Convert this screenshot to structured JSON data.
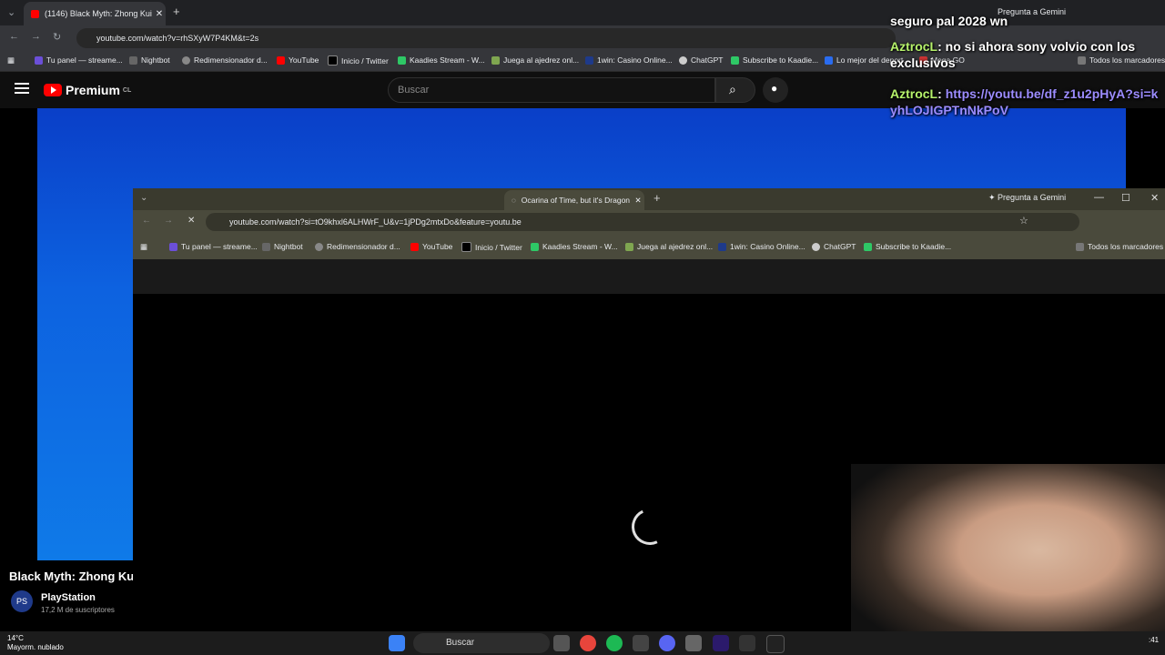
{
  "back_browser": {
    "tab_title": "(1146) Black Myth: Zhong Kui -",
    "url": "youtube.com/watch?v=rhSXyW7P4KM&t=2s",
    "new_tab": "+",
    "bookmarks": [
      "Tu panel — streame...",
      "Nightbot",
      "Redimensionador d...",
      "YouTube",
      "Inicio / Twitter",
      "Kaadies Stream - W...",
      "Juega al ajedrez onl...",
      "1win: Casino Online...",
      "ChatGPT",
      "Subscribe to Kaadie...",
      "Lo mejor del deport...",
      "Mega GO"
    ],
    "bookmarks_all": "Todos los marcadores",
    "gemini": "Pregunta a Gemini"
  },
  "youtube": {
    "logo": "Premium",
    "region": "CL",
    "search_placeholder": "Buscar",
    "video_title": "Black Myth: Zhong Kui",
    "channel": "PlayStation",
    "subscribers": "17,2 M de suscriptores"
  },
  "chat": [
    {
      "user": "",
      "text": "seguro pal 2028 wn"
    },
    {
      "user": "AztrocL",
      "text": ": no si ahora sony volvio con los exclusivos"
    },
    {
      "user": "AztrocL",
      "text": ": ",
      "link": "https://youtu.be/df_z1u2pHyA?si=kyhLOJIGPTnNkPoV"
    }
  ],
  "front_browser": {
    "tab_title": "Ocarina of Time, but it's Dragon",
    "url": "youtube.com/watch?si=tO9khxl6ALHWrF_U&v=1jPDg2mtxDo&feature=youtu.be",
    "gemini": "Pregunta a Gemini",
    "bookmarks": [
      "Tu panel — streame...",
      "Nightbot",
      "Redimensionador d...",
      "YouTube",
      "Inicio / Twitter",
      "Kaadies Stream - W...",
      "Juega al ajedrez onl...",
      "1win: Casino Online...",
      "ChatGPT",
      "Subscribe to Kaadie..."
    ],
    "bookmarks_all": "Todos los marcadores"
  },
  "taskbar": {
    "temperature": "14°C",
    "weather": "Mayorm. nublado",
    "search": "Buscar",
    "time": ":41"
  }
}
